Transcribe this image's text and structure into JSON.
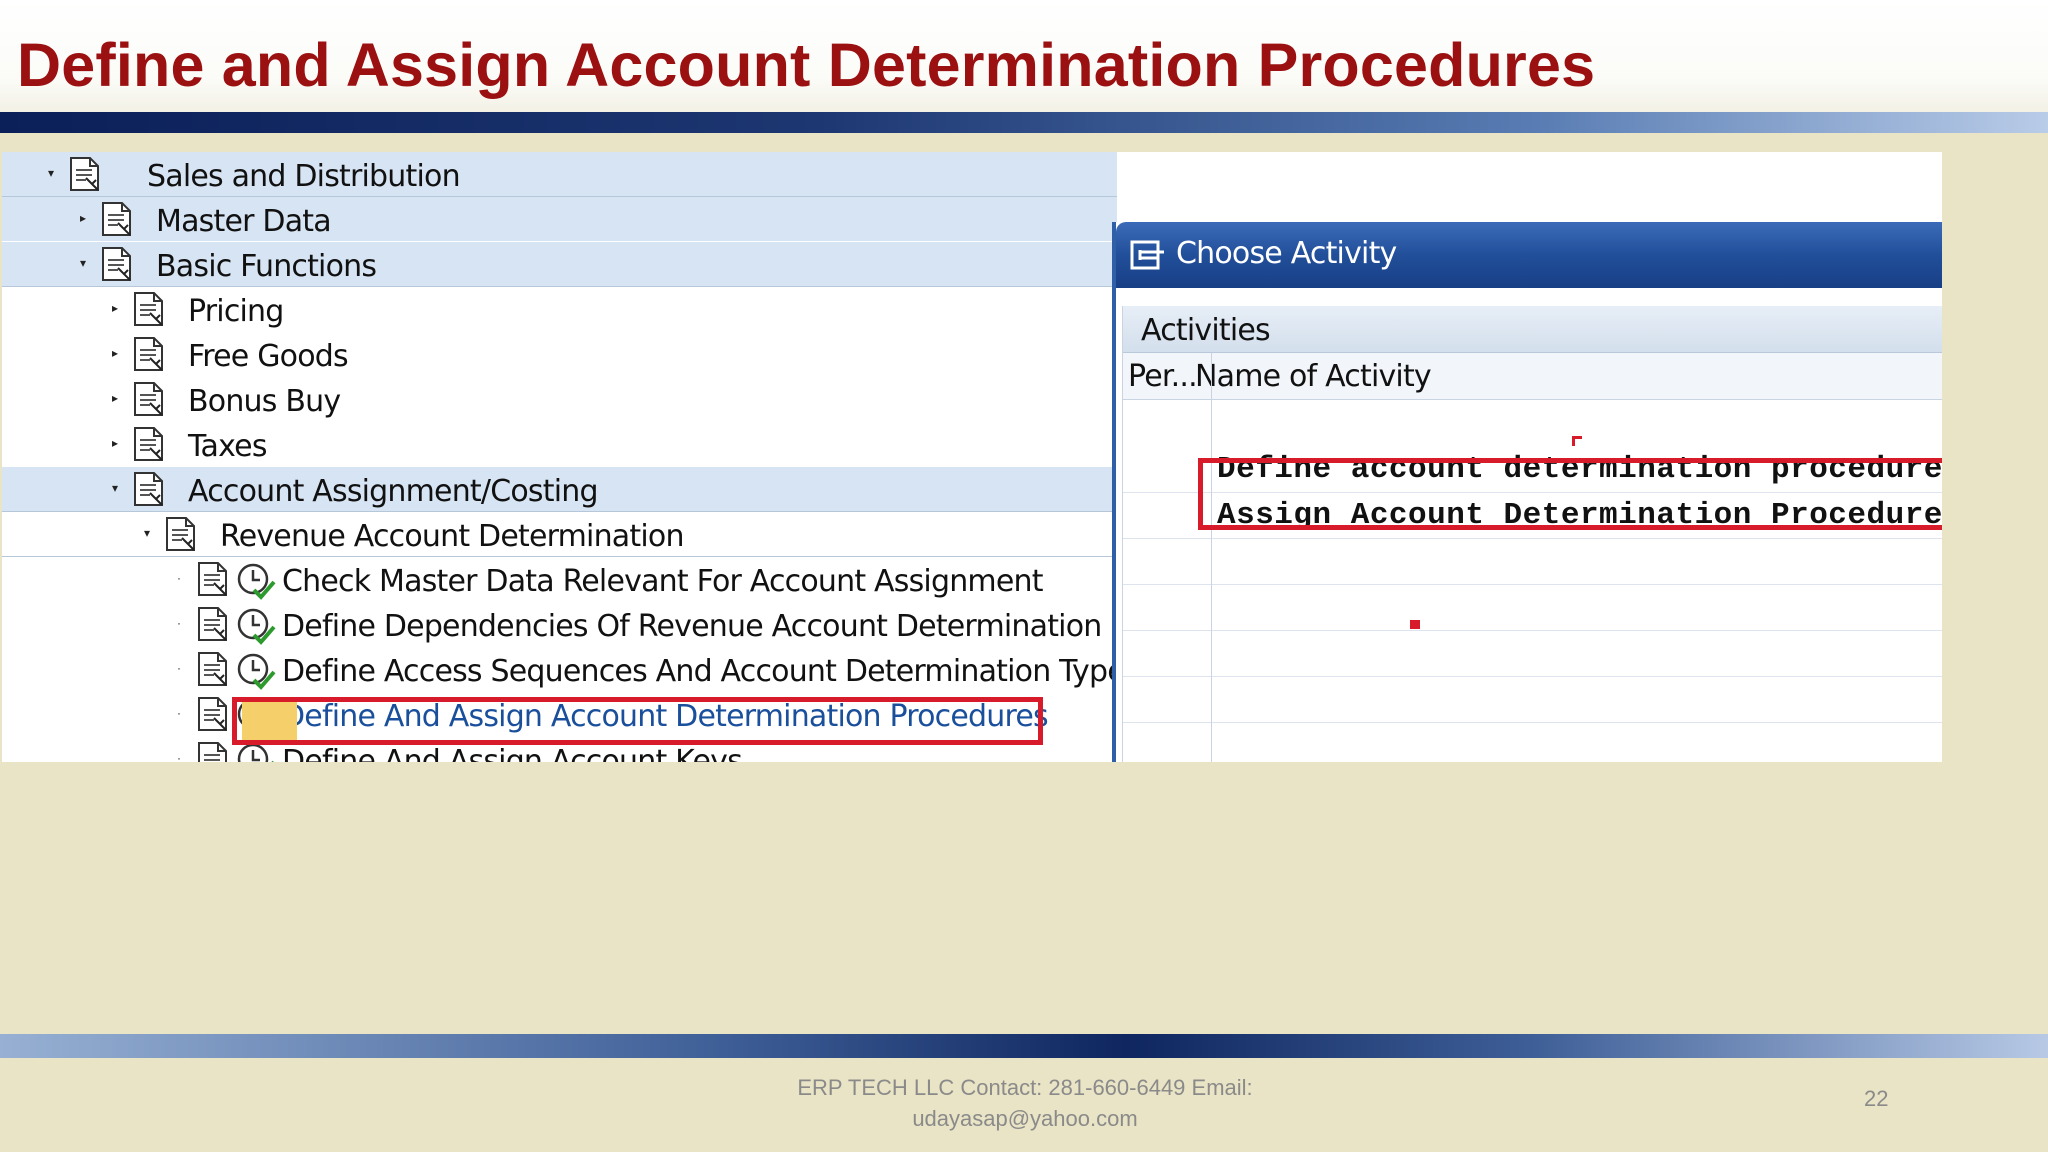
{
  "slide": {
    "title": "Define and Assign Account Determination Procedures",
    "footer": "ERP TECH LLC Contact: 281-660-6449 Email: udayasap@yahoo.com",
    "page_number": "22",
    "colors": {
      "title": "#9b1010",
      "highlight_box": "#d81b2a",
      "band": "#0b1f58"
    }
  },
  "tree": {
    "items": [
      {
        "label": "Sales and Distribution",
        "expander": "▾"
      },
      {
        "label": "Master Data",
        "expander": "▸"
      },
      {
        "label": "Basic Functions",
        "expander": "▾"
      },
      {
        "label": "Pricing",
        "expander": "▸"
      },
      {
        "label": "Free Goods",
        "expander": "▸"
      },
      {
        "label": "Bonus Buy",
        "expander": "▸"
      },
      {
        "label": "Taxes",
        "expander": "▸"
      },
      {
        "label": "Account Assignment/Costing",
        "expander": "▾"
      },
      {
        "label": "Revenue Account Determination",
        "expander": "▾"
      },
      {
        "label": "Check Master Data Relevant For Account Assignment",
        "expander": "·"
      },
      {
        "label": "Define Dependencies Of Revenue Account Determination",
        "expander": "·"
      },
      {
        "label": "Define Access Sequences And Account Determination Types",
        "expander": "·"
      },
      {
        "label": "Define And Assign Account Determination Procedures",
        "expander": "·",
        "selected": true
      },
      {
        "label": "Define And Assign Account Keys",
        "expander": "·"
      }
    ],
    "icons": {
      "node": "document-node-icon",
      "activity": "clock-check-icon"
    }
  },
  "dialog": {
    "title": "Choose Activity",
    "icon": "choose-activity-icon",
    "section": "Activities",
    "columns": {
      "performed": "Per...",
      "name": "Name of Activity"
    },
    "rows": [
      "Define account determination procedure",
      "Assign Account Determination Procedure"
    ]
  }
}
